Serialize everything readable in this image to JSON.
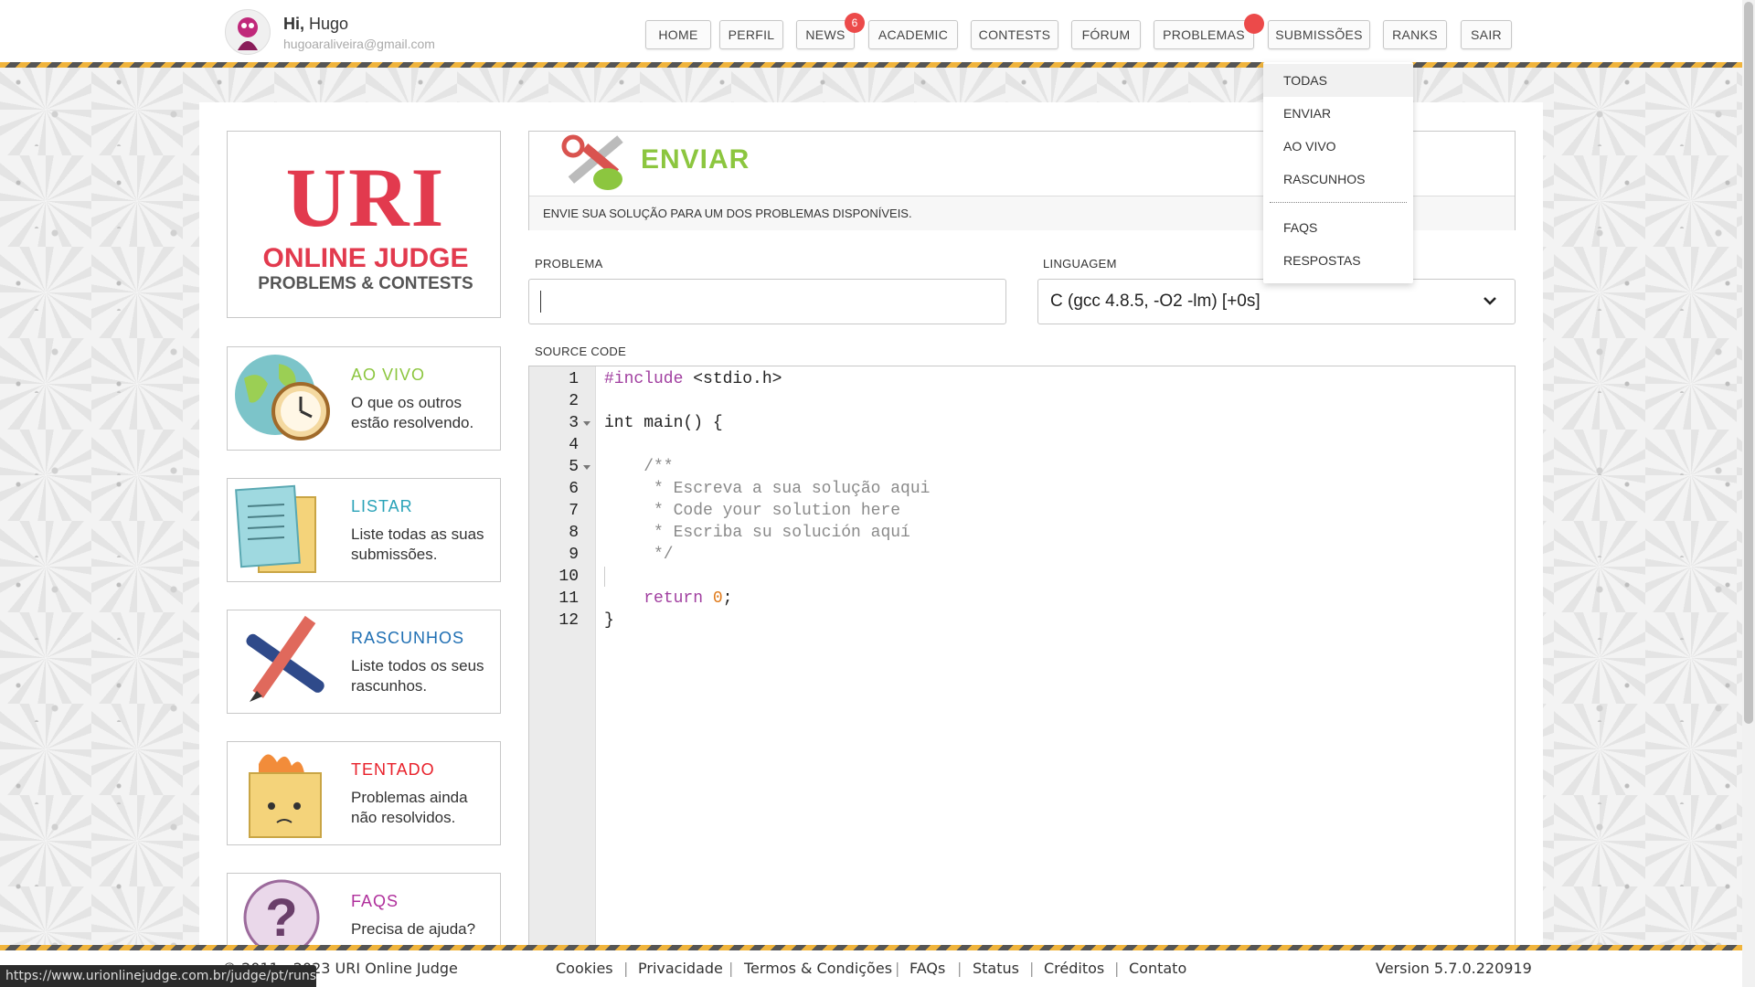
{
  "user": {
    "greeting_bold": "Hi,",
    "name": "Hugo",
    "email": "hugoaraliveira@gmail.com"
  },
  "nav": {
    "home": "HOME",
    "perfil": "PERFIL",
    "news": "NEWS",
    "news_badge": "6",
    "academic": "ACADEMIC",
    "contests": "CONTESTS",
    "forum": "FÓRUM",
    "problemas": "PROBLEMAS",
    "submissoes": "SUBMISSÕES",
    "ranks": "RANKS",
    "sair": "SAIR"
  },
  "dropdown": {
    "items": [
      "TODAS",
      "ENVIAR",
      "AO VIVO",
      "RASCUNHOS",
      "FAQS",
      "RESPOSTAS"
    ]
  },
  "logo": {
    "uri": "URI",
    "online_judge": "ONLINE JUDGE",
    "problems_contests": "PROBLEMS & CONTESTS"
  },
  "sidebar": [
    {
      "title": "AO VIVO",
      "desc": "O que os outros estão resolvendo.",
      "color": "#8cc63f"
    },
    {
      "title": "LISTAR",
      "desc": "Liste todas as suas submissões.",
      "color": "#2aa3b8"
    },
    {
      "title": "RASCUNHOS",
      "desc": "Liste todos os seus rascunhos.",
      "color": "#1f6fb3"
    },
    {
      "title": "TENTADO",
      "desc": "Problemas ainda não resolvidos.",
      "color": "#e8202a"
    },
    {
      "title": "FAQS",
      "desc": "Precisa de ajuda?",
      "color": "#b0309c"
    }
  ],
  "enviar": {
    "title": "ENVIAR",
    "subtitle": "ENVIE SUA SOLUÇÃO PARA UM DOS PROBLEMAS DISPONÍVEIS."
  },
  "form": {
    "problem_label": "PROBLEMA",
    "problem_value": "",
    "language_label": "LINGUAGEM",
    "language_value": "C (gcc 4.8.5, -O2 -lm) [+0s]",
    "source_label": "SOURCE CODE"
  },
  "code": {
    "line_numbers": [
      "1",
      "2",
      "3",
      "4",
      "5",
      "6",
      "7",
      "8",
      "9",
      "10",
      "11",
      "12"
    ],
    "include_kw": "#include",
    "include_rest": " <stdio.h>",
    "line3": "int main() {",
    "line5": "    /**",
    "line6": "     * Escreva a sua solução aqui",
    "line7": "     * Code your solution here",
    "line8": "     * Escriba su solución aquí",
    "line9": "     */",
    "return_indent": "    ",
    "return_kw": "return",
    "return_space": " ",
    "return_num": "0",
    "return_end": ";",
    "line12": "}"
  },
  "footer": {
    "copyright": "© 2011 - 2023 URI Online Judge",
    "links": [
      "Cookies",
      "Privacidade",
      "Termos & Condições",
      "FAQs",
      "Status",
      "Créditos",
      "Contato"
    ],
    "version": "Version 5.7.0.220919"
  },
  "status_url": "https://www.urionlinejudge.com.br/judge/pt/runs",
  "colors": {
    "accent_green": "#8cc63f",
    "brand_red": "#e23a4e",
    "badge_red": "#ec4a4a"
  }
}
